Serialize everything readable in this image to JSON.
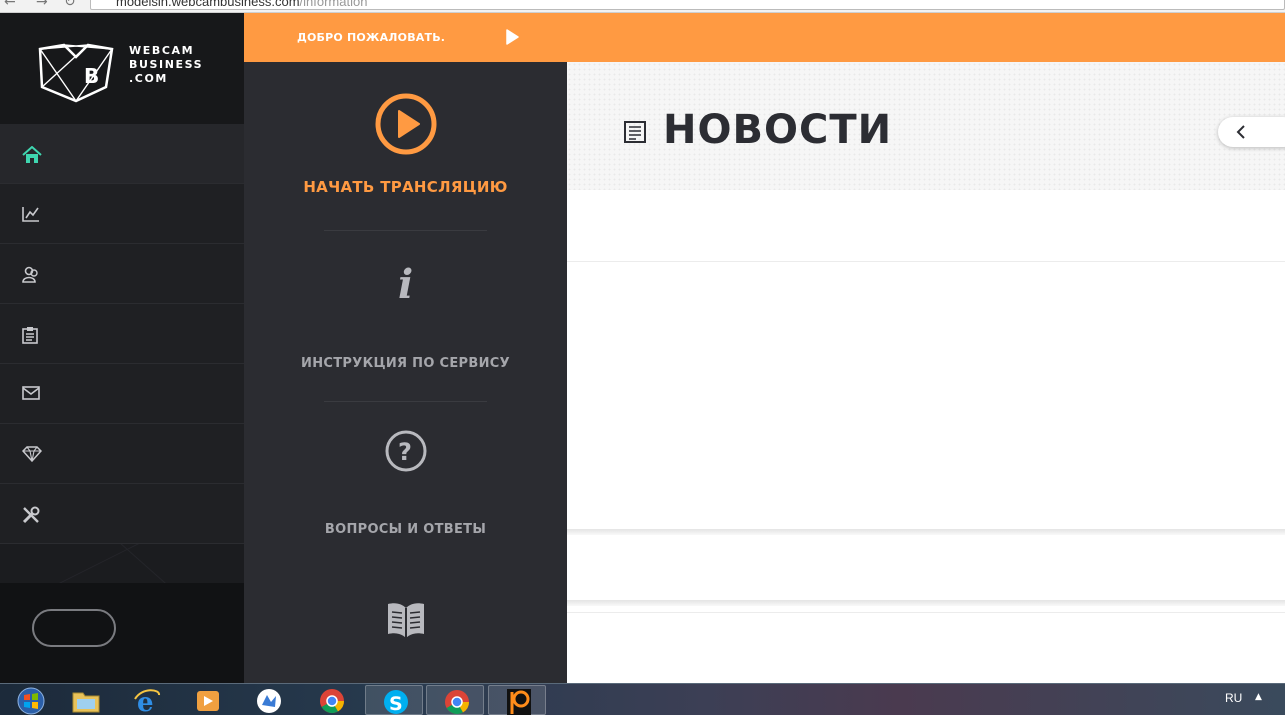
{
  "browser": {
    "url_host": "modelsin.webcambusiness.com",
    "url_path": "/information"
  },
  "logo": {
    "line1": "WEBCAM",
    "line2": "BUSINESS",
    "line3": ".COM",
    "letter": "B"
  },
  "sidebar": {
    "items": [
      {
        "icon": "home-icon",
        "active": true
      },
      {
        "icon": "chart-icon"
      },
      {
        "icon": "users-icon"
      },
      {
        "icon": "clipboard-icon"
      },
      {
        "icon": "mail-icon"
      },
      {
        "icon": "diamond-icon"
      },
      {
        "icon": "tools-icon"
      }
    ]
  },
  "topbar": {
    "welcome": "ДОБРО ПОЖАЛОВАТЬ."
  },
  "panel": {
    "start_stream": "НАЧАТЬ ТРАНСЛЯЦИЮ",
    "instructions": "ИНСТРУКЦИЯ ПО СЕРВИСУ",
    "faq": "ВОПРОСЫ И ОТВЕТЫ"
  },
  "main": {
    "title": "НОВОСТИ"
  },
  "taskbar": {
    "lang": "RU"
  },
  "colors": {
    "accent": "#ff9a42",
    "sidebar": "#1b1c1f",
    "panel": "#2b2c31",
    "active_icon": "#3fd6b0"
  }
}
